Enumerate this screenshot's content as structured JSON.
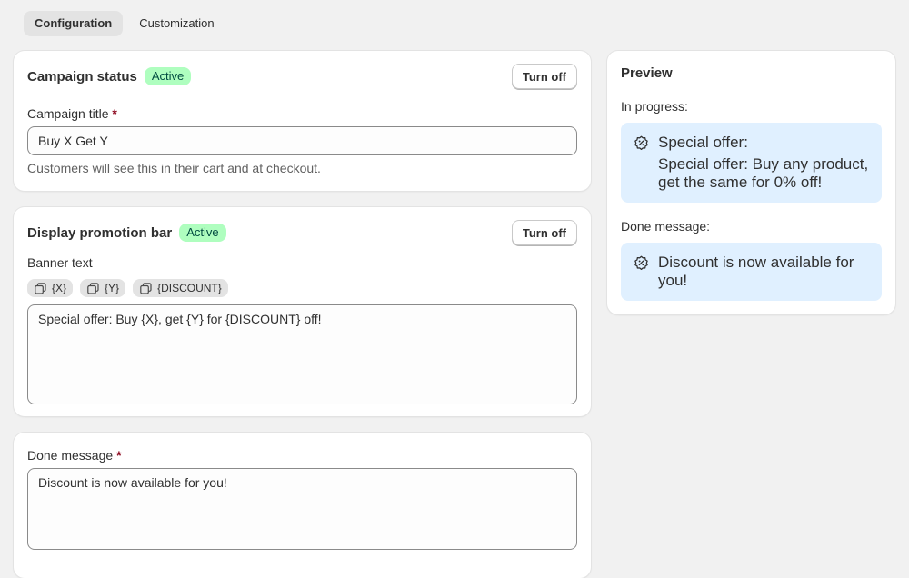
{
  "tabs": [
    {
      "label": "Configuration",
      "active": true
    },
    {
      "label": "Customization",
      "active": false
    }
  ],
  "campaign_status": {
    "title": "Campaign status",
    "badge": "Active",
    "button": "Turn off",
    "field_label": "Campaign title",
    "required_mark": "*",
    "field_value": "Buy X Get Y",
    "help": "Customers will see this in their cart and at checkout."
  },
  "promotion_bar": {
    "title": "Display promotion bar",
    "badge": "Active",
    "button": "Turn off",
    "field_label": "Banner text",
    "chips": [
      "{X}",
      "{Y}",
      "{DISCOUNT}"
    ],
    "field_value": "Special offer: Buy {X}, get {Y} for {DISCOUNT} off!"
  },
  "done_message": {
    "field_label": "Done message",
    "required_mark": "*",
    "field_value": "Discount is now available for you!"
  },
  "preview": {
    "title": "Preview",
    "in_progress_label": "In progress:",
    "in_progress_heading": "Special offer:",
    "in_progress_text": "Special offer: Buy any product, get the same for 0% off!",
    "done_label": "Done message:",
    "done_text": "Discount is now available for you!"
  },
  "colors": {
    "badge_bg": "#affebf",
    "preview_bg": "#e0f0ff",
    "required": "#8e0b21"
  },
  "icons": [
    "copy-icon",
    "discount-badge-icon"
  ]
}
